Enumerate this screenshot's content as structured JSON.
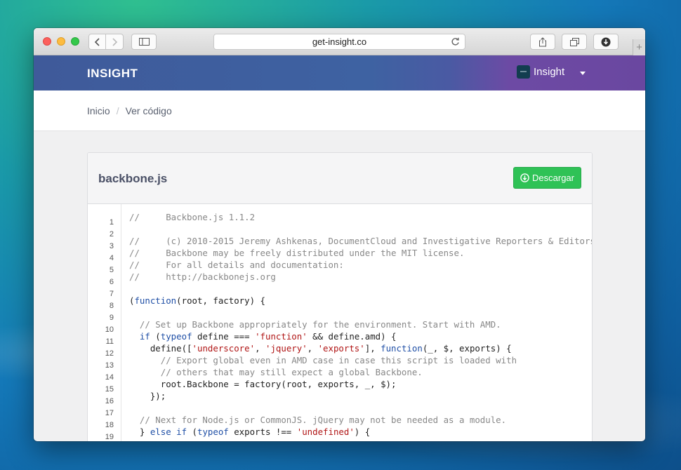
{
  "browser": {
    "url": "get-insight.co",
    "new_tab_label": "+"
  },
  "navbar": {
    "brand": "INSIGHT",
    "user_name": "Insight"
  },
  "breadcrumb": {
    "home": "Inicio",
    "separator": "/",
    "current": "Ver código"
  },
  "file": {
    "title": "backbone.js",
    "download_label": "Descargar"
  },
  "colors": {
    "navbar_start": "#3f5a9a",
    "navbar_end": "#6a47a0",
    "download_button": "#2fc256",
    "keyword": "#1f4fa6",
    "string": "#b01515",
    "comment": "#888888"
  },
  "icons": [
    "back-icon",
    "forward-icon",
    "sidebar-icon",
    "reload-icon",
    "share-icon",
    "tabs-icon",
    "downloads-icon",
    "download-circle-icon",
    "caret-down-icon"
  ],
  "code": {
    "line_numbers": [
      "1",
      "2",
      "3",
      "4",
      "5",
      "6",
      "7",
      "8",
      "9",
      "10",
      "11",
      "12",
      "13",
      "14",
      "15",
      "16",
      "17",
      "18",
      "19"
    ],
    "lines": [
      [
        {
          "t": "cm",
          "v": "//     Backbone.js 1.1.2"
        }
      ],
      [],
      [
        {
          "t": "cm",
          "v": "//     (c) 2010-2015 Jeremy Ashkenas, DocumentCloud and Investigative Reporters & Editors"
        }
      ],
      [
        {
          "t": "cm",
          "v": "//     Backbone may be freely distributed under the MIT license."
        }
      ],
      [
        {
          "t": "cm",
          "v": "//     For all details and documentation:"
        }
      ],
      [
        {
          "t": "cm",
          "v": "//     http://backbonejs.org"
        }
      ],
      [],
      [
        {
          "t": "p",
          "v": "("
        },
        {
          "t": "kw",
          "v": "function"
        },
        {
          "t": "p",
          "v": "(root, factory) {"
        }
      ],
      [],
      [
        {
          "t": "cm",
          "v": "  // Set up Backbone appropriately for the environment. Start with AMD."
        }
      ],
      [
        {
          "t": "p",
          "v": "  "
        },
        {
          "t": "kw",
          "v": "if"
        },
        {
          "t": "p",
          "v": " ("
        },
        {
          "t": "kw",
          "v": "typeof"
        },
        {
          "t": "p",
          "v": " define === "
        },
        {
          "t": "str",
          "v": "'function'"
        },
        {
          "t": "p",
          "v": " && define.amd) {"
        }
      ],
      [
        {
          "t": "p",
          "v": "    define(["
        },
        {
          "t": "str",
          "v": "'underscore'"
        },
        {
          "t": "p",
          "v": ", "
        },
        {
          "t": "str",
          "v": "'jquery'"
        },
        {
          "t": "p",
          "v": ", "
        },
        {
          "t": "str",
          "v": "'exports'"
        },
        {
          "t": "p",
          "v": "], "
        },
        {
          "t": "kw",
          "v": "function"
        },
        {
          "t": "p",
          "v": "(_, $, exports) {"
        }
      ],
      [
        {
          "t": "cm",
          "v": "      // Export global even in AMD case in case this script is loaded with"
        }
      ],
      [
        {
          "t": "cm",
          "v": "      // others that may still expect a global Backbone."
        }
      ],
      [
        {
          "t": "p",
          "v": "      root.Backbone = factory(root, exports, _, $);"
        }
      ],
      [
        {
          "t": "p",
          "v": "    });"
        }
      ],
      [],
      [
        {
          "t": "cm",
          "v": "  // Next for Node.js or CommonJS. jQuery may not be needed as a module."
        }
      ],
      [
        {
          "t": "p",
          "v": "  } "
        },
        {
          "t": "kw",
          "v": "else if"
        },
        {
          "t": "p",
          "v": " ("
        },
        {
          "t": "kw",
          "v": "typeof"
        },
        {
          "t": "p",
          "v": " exports !== "
        },
        {
          "t": "str",
          "v": "'undefined'"
        },
        {
          "t": "p",
          "v": ") {"
        }
      ]
    ]
  }
}
